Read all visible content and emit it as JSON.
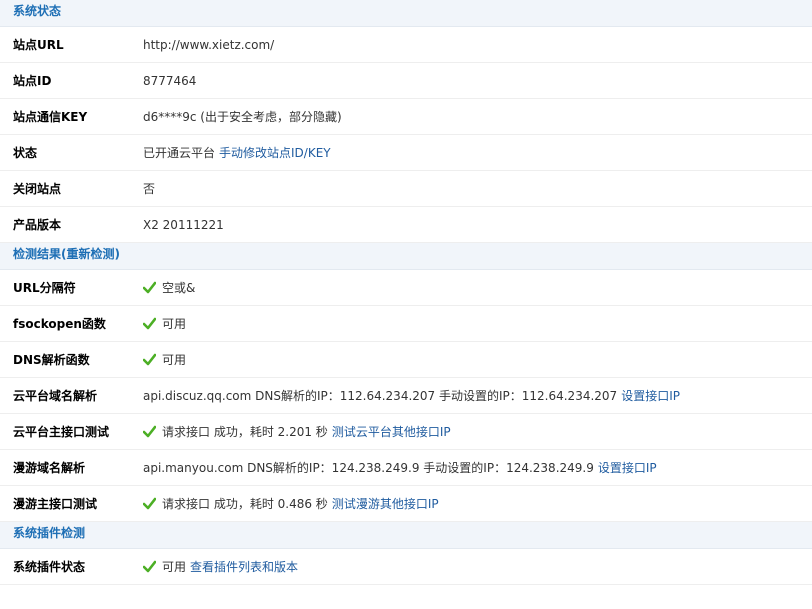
{
  "sections": {
    "status": {
      "title": "系统状态"
    },
    "detect": {
      "title": "检测结果(重新检测)"
    },
    "plugin": {
      "title": "系统插件检测"
    }
  },
  "status_rows": [
    {
      "label": "站点URL",
      "value": "http://www.xietz.com/"
    },
    {
      "label": "站点ID",
      "value": "8777464"
    },
    {
      "label": "站点通信KEY",
      "value": "d6****9c (出于安全考虑，部分隐藏)"
    },
    {
      "label": "状态",
      "value": "已开通云平台",
      "link": "手动修改站点ID/KEY"
    },
    {
      "label": "关闭站点",
      "value": "否"
    },
    {
      "label": "产品版本",
      "value": "X2 20111221"
    }
  ],
  "detect_rows": [
    {
      "label": "URL分隔符",
      "value": "空或&"
    },
    {
      "label": "fsockopen函数",
      "value": "可用"
    },
    {
      "label": "DNS解析函数",
      "value": "可用"
    },
    {
      "label": "云平台域名解析",
      "value": "api.discuz.qq.com DNS解析的IP：112.64.234.207 手动设置的IP：112.64.234.207",
      "link": "设置接口IP"
    },
    {
      "label": "云平台主接口测试",
      "value": "请求接口 成功，耗时 2.201 秒",
      "link": "测试云平台其他接口IP"
    },
    {
      "label": "漫游域名解析",
      "value": "api.manyou.com DNS解析的IP：124.238.249.9 手动设置的IP：124.238.249.9",
      "link": "设置接口IP"
    },
    {
      "label": "漫游主接口测试",
      "value": "请求接口 成功，耗时 0.486 秒",
      "link": "测试漫游其他接口IP"
    }
  ],
  "plugin_rows": [
    {
      "label": "系统插件状态",
      "value": "可用",
      "link": "查看插件列表和版本"
    }
  ],
  "colors": {
    "accent": "#1e6fb5",
    "link": "#1f5b9f",
    "check": "#4caf25",
    "header_bg": "#f1f5fa"
  },
  "icons": {
    "check": "check-icon"
  }
}
